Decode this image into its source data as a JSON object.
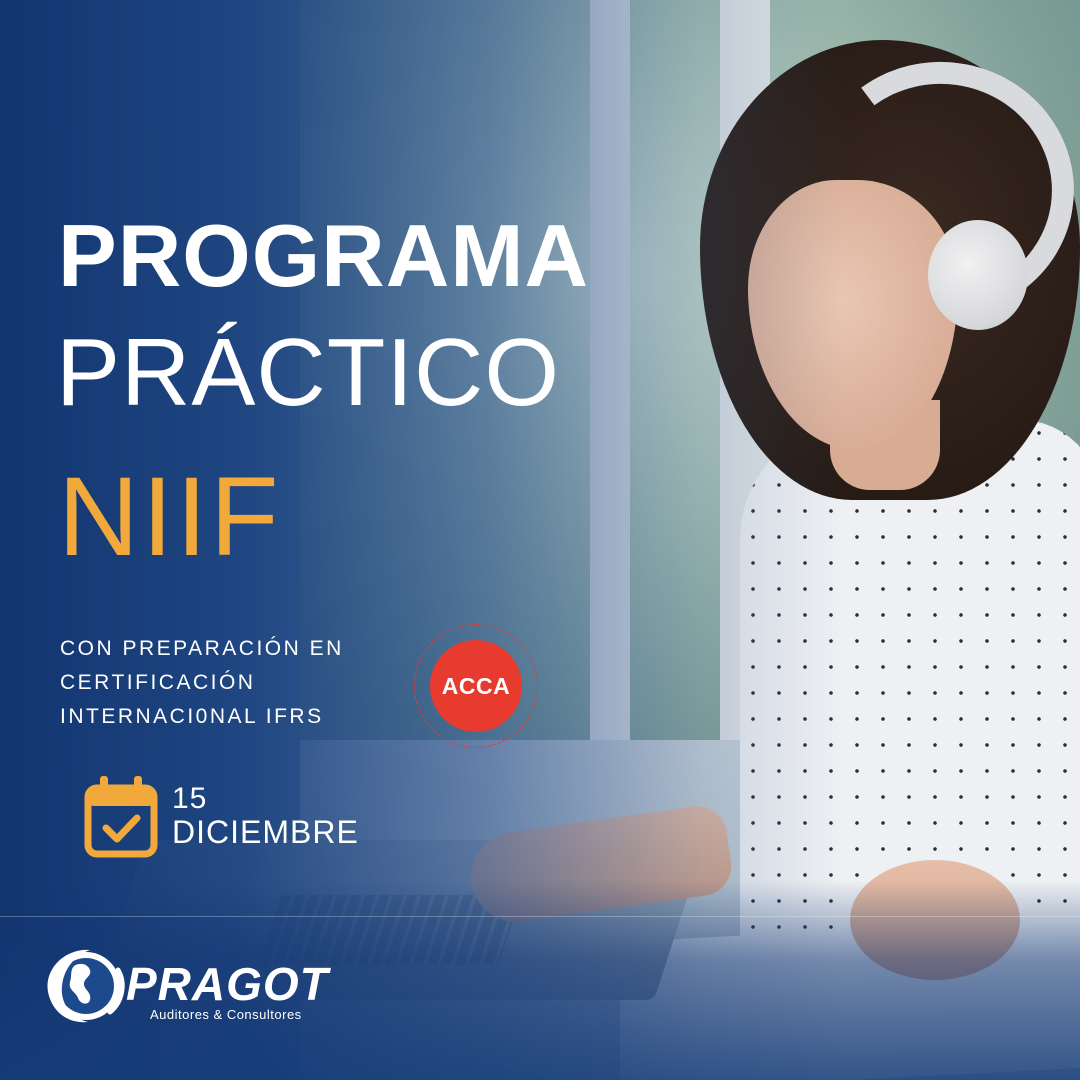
{
  "headline": {
    "line1": "PROGRAMA",
    "line2": "PRÁCTICO",
    "line3": "NIIF"
  },
  "subtitle": {
    "line1": "CON PREPARACIÓN EN",
    "line2": "CERTIFICACIÓN",
    "line3": "INTERNACI0NAL IFRS"
  },
  "badge": {
    "label": "ACCA"
  },
  "date": {
    "day": "15",
    "month": "DICIEMBRE"
  },
  "brand": {
    "name": "PRAGOT",
    "tagline": "Auditores & Consultores"
  },
  "icons": {
    "calendar": "calendar-check-icon",
    "logo": "globe-logo-icon"
  },
  "colors": {
    "accent": "#f2a93b",
    "badge": "#e63b2e",
    "primary": "#16407f",
    "text": "#ffffff"
  }
}
